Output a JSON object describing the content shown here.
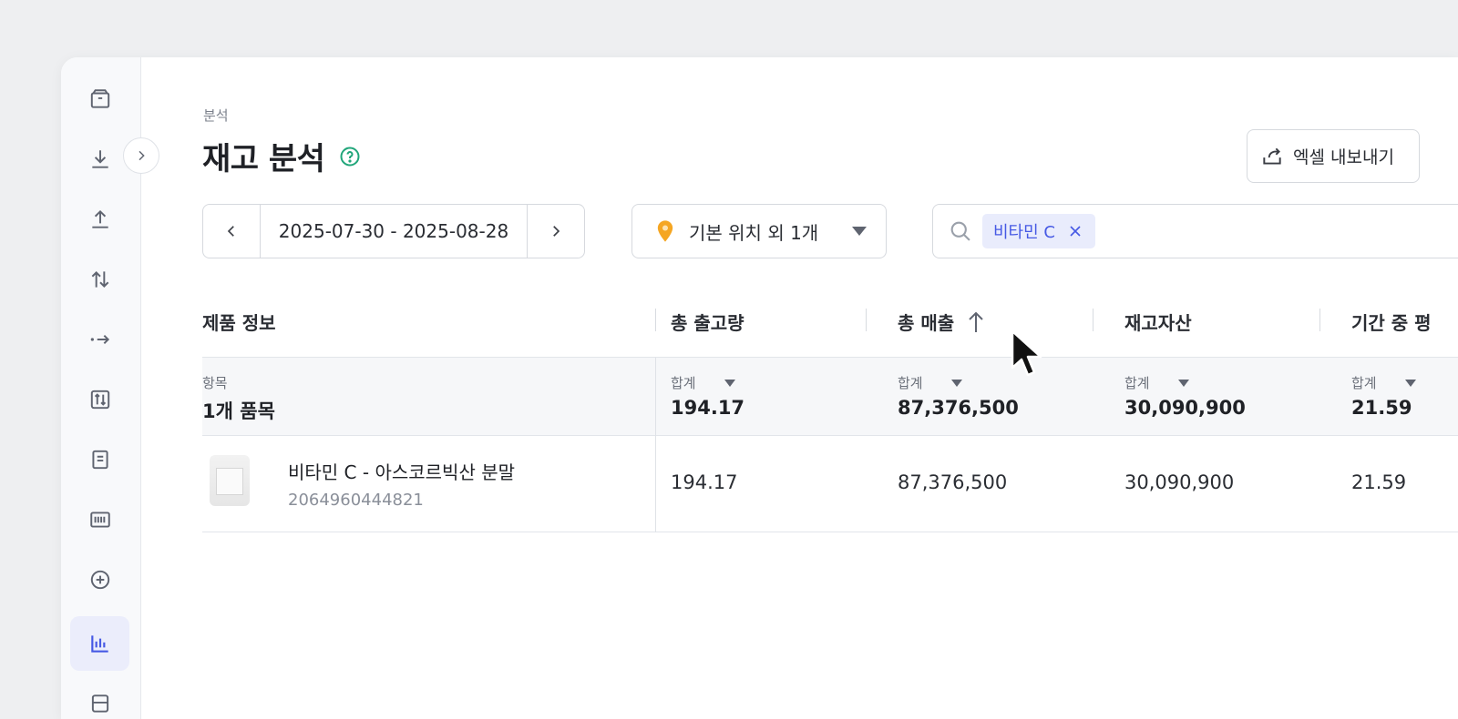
{
  "breadcrumb": "분석",
  "page_title": "재고 분석",
  "export_button": "엑셀 내보내기",
  "date_range": "2025-07-30 - 2025-08-28",
  "location_select": "기본 위치 외 1개",
  "search": {
    "chip_label": "비타민 C"
  },
  "table": {
    "headers": [
      "제품 정보",
      "총 출고량",
      "총 매출",
      "재고자산",
      "기간 중 평"
    ],
    "summary": {
      "item_label": "항목",
      "item_value": "1개 품목",
      "agg_label": "합계",
      "values": [
        "194.17",
        "87,376,500",
        "30,090,900",
        "21.59"
      ]
    },
    "rows": [
      {
        "name": "비타민 C - 아스코르빅산 분말",
        "code": "2064960444821",
        "values": [
          "194.17",
          "87,376,500",
          "30,090,900",
          "21.59"
        ]
      }
    ]
  },
  "sidebar": {
    "items": [
      "box-icon",
      "inbound-icon",
      "outbound-icon",
      "transfer-icon",
      "move-icon",
      "adjust-icon",
      "document-icon",
      "barcode-icon",
      "add-icon",
      "analytics-icon",
      "storage-icon"
    ],
    "active_index": 9
  },
  "colors": {
    "accent": "#4659e4",
    "help": "#21a67a",
    "pin": "#f5a623"
  }
}
